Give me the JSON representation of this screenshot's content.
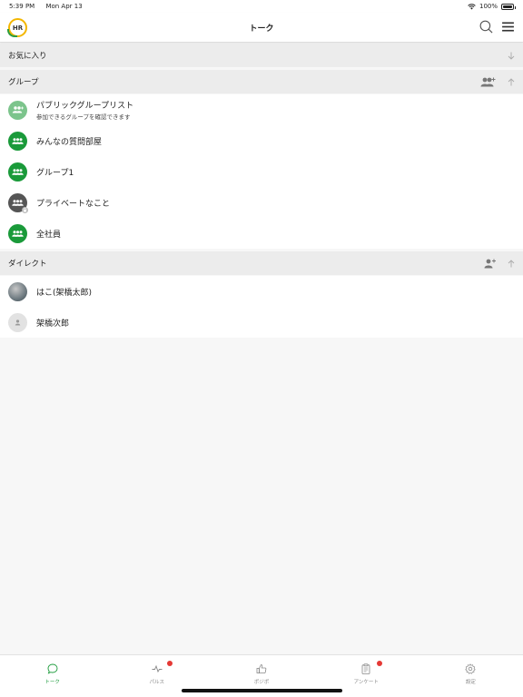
{
  "status_bar": {
    "time": "5:39 PM",
    "date": "Mon Apr 13",
    "battery": "100%"
  },
  "header": {
    "title": "トーク",
    "logo_text": "HR"
  },
  "favorites": {
    "label": "お気に入り"
  },
  "groups": {
    "label": "グループ",
    "items": [
      {
        "label": "パブリックグループリスト",
        "sub": "参加できるグループを確認できます",
        "icon": "group-add-icon"
      },
      {
        "label": "みんなの質問部屋",
        "icon": "group-icon"
      },
      {
        "label": "グループ1",
        "icon": "group-icon"
      },
      {
        "label": "プライベートなこと",
        "icon": "private-group-icon"
      },
      {
        "label": "全社員",
        "icon": "group-icon"
      }
    ]
  },
  "direct": {
    "label": "ダイレクト",
    "items": [
      {
        "label": "はこ(架橋太郎)",
        "icon": "user-photo"
      },
      {
        "label": "架橋次郎",
        "icon": "user-icon"
      }
    ]
  },
  "tabs": [
    {
      "label": "トーク",
      "icon": "chat-bubble-icon",
      "active": true
    },
    {
      "label": "パルス",
      "icon": "pulse-icon",
      "badge": true
    },
    {
      "label": "ポジポ",
      "icon": "thumbs-up-icon"
    },
    {
      "label": "アンケート",
      "icon": "clipboard-icon",
      "badge": true
    },
    {
      "label": "設定",
      "icon": "gear-icon"
    }
  ],
  "colors": {
    "accent": "#1a9a3a",
    "badge": "#e53935",
    "logo_ring": "#f3b600"
  }
}
